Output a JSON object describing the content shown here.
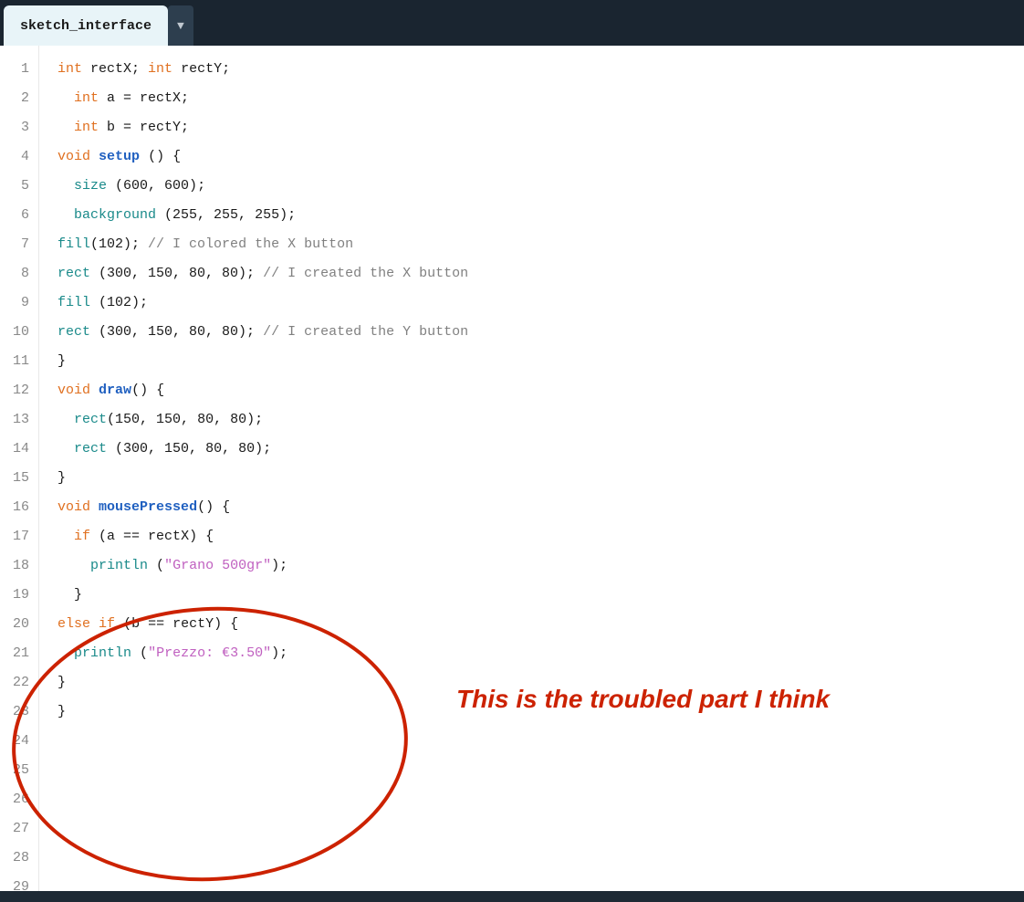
{
  "tab": {
    "label": "sketch_interface",
    "arrow": "▼"
  },
  "lines": [
    {
      "num": 1,
      "tokens": [
        {
          "t": "int",
          "c": "kw-orange"
        },
        {
          "t": " rectX; ",
          "c": "plain"
        },
        {
          "t": "int",
          "c": "kw-orange"
        },
        {
          "t": " rectY;",
          "c": "plain"
        }
      ]
    },
    {
      "num": 2,
      "tokens": [
        {
          "t": "  ",
          "c": "plain"
        },
        {
          "t": "int",
          "c": "kw-orange"
        },
        {
          "t": " a = rectX;",
          "c": "plain"
        }
      ]
    },
    {
      "num": 3,
      "tokens": [
        {
          "t": "  ",
          "c": "plain"
        },
        {
          "t": "int",
          "c": "kw-orange"
        },
        {
          "t": " b = rectY;",
          "c": "plain"
        }
      ]
    },
    {
      "num": 4,
      "tokens": [
        {
          "t": "",
          "c": "plain"
        }
      ]
    },
    {
      "num": 5,
      "tokens": [
        {
          "t": "void",
          "c": "kw-orange"
        },
        {
          "t": " ",
          "c": "plain"
        },
        {
          "t": "setup",
          "c": "kw-blue"
        },
        {
          "t": " () {",
          "c": "plain"
        }
      ]
    },
    {
      "num": 6,
      "tokens": [
        {
          "t": "  ",
          "c": "plain"
        },
        {
          "t": "size",
          "c": "fn-teal"
        },
        {
          "t": " (600, 600);",
          "c": "plain"
        }
      ]
    },
    {
      "num": 7,
      "tokens": [
        {
          "t": "  ",
          "c": "plain"
        },
        {
          "t": "background",
          "c": "fn-teal"
        },
        {
          "t": " (255, 255, 255);",
          "c": "plain"
        }
      ]
    },
    {
      "num": 8,
      "tokens": [
        {
          "t": "",
          "c": "plain"
        }
      ]
    },
    {
      "num": 9,
      "tokens": [
        {
          "t": "fill",
          "c": "fn-teal"
        },
        {
          "t": "(102); ",
          "c": "plain"
        },
        {
          "t": "// I colored the X button",
          "c": "comment"
        }
      ]
    },
    {
      "num": 10,
      "tokens": [
        {
          "t": "rect",
          "c": "fn-teal"
        },
        {
          "t": " (300, 150, 80, 80); ",
          "c": "plain"
        },
        {
          "t": "// I created the X button",
          "c": "comment"
        }
      ]
    },
    {
      "num": 11,
      "tokens": [
        {
          "t": "",
          "c": "plain"
        }
      ]
    },
    {
      "num": 12,
      "tokens": [
        {
          "t": "fill",
          "c": "fn-teal"
        },
        {
          "t": " (102);",
          "c": "plain"
        }
      ]
    },
    {
      "num": 13,
      "tokens": [
        {
          "t": "rect",
          "c": "fn-teal"
        },
        {
          "t": " (300, 150, 80, 80); ",
          "c": "plain"
        },
        {
          "t": "// I created the Y button",
          "c": "comment"
        }
      ]
    },
    {
      "num": 14,
      "tokens": [
        {
          "t": "}",
          "c": "plain"
        }
      ]
    },
    {
      "num": 15,
      "tokens": [
        {
          "t": "",
          "c": "plain"
        }
      ]
    },
    {
      "num": 16,
      "tokens": [
        {
          "t": "void",
          "c": "kw-orange"
        },
        {
          "t": " ",
          "c": "plain"
        },
        {
          "t": "draw",
          "c": "kw-blue"
        },
        {
          "t": "() {",
          "c": "plain"
        }
      ]
    },
    {
      "num": 17,
      "tokens": [
        {
          "t": "  ",
          "c": "plain"
        },
        {
          "t": "rect",
          "c": "fn-teal"
        },
        {
          "t": "(150, 150, 80, 80);",
          "c": "plain"
        }
      ]
    },
    {
      "num": 18,
      "tokens": [
        {
          "t": "  ",
          "c": "plain"
        },
        {
          "t": "rect",
          "c": "fn-teal"
        },
        {
          "t": " (300, 150, 80, 80);",
          "c": "plain"
        }
      ]
    },
    {
      "num": 19,
      "tokens": [
        {
          "t": "}",
          "c": "plain"
        }
      ]
    },
    {
      "num": 20,
      "tokens": [
        {
          "t": "",
          "c": "plain"
        }
      ]
    },
    {
      "num": 21,
      "tokens": [
        {
          "t": "void",
          "c": "kw-orange"
        },
        {
          "t": " ",
          "c": "plain"
        },
        {
          "t": "mousePressed",
          "c": "kw-blue"
        },
        {
          "t": "() {",
          "c": "plain"
        }
      ]
    },
    {
      "num": 22,
      "tokens": [
        {
          "t": "  ",
          "c": "plain"
        },
        {
          "t": "if",
          "c": "kw-orange"
        },
        {
          "t": " (a == rectX) {",
          "c": "plain"
        }
      ]
    },
    {
      "num": 23,
      "tokens": [
        {
          "t": "    ",
          "c": "plain"
        },
        {
          "t": "println",
          "c": "fn-teal"
        },
        {
          "t": " (",
          "c": "plain"
        },
        {
          "t": "\"Grano 500gr\"",
          "c": "str"
        },
        {
          "t": ");",
          "c": "plain"
        }
      ]
    },
    {
      "num": 24,
      "tokens": [
        {
          "t": "  }",
          "c": "plain"
        }
      ]
    },
    {
      "num": 25,
      "tokens": [
        {
          "t": "else",
          "c": "kw-orange"
        },
        {
          "t": " ",
          "c": "plain"
        },
        {
          "t": "if",
          "c": "kw-orange"
        },
        {
          "t": " (b == rectY) {",
          "c": "plain"
        }
      ]
    },
    {
      "num": 26,
      "tokens": [
        {
          "t": "  ",
          "c": "plain"
        },
        {
          "t": "println",
          "c": "fn-teal"
        },
        {
          "t": " (",
          "c": "plain"
        },
        {
          "t": "\"Prezzo: €3.50\"",
          "c": "str"
        },
        {
          "t": ");",
          "c": "plain"
        }
      ]
    },
    {
      "num": 27,
      "tokens": [
        {
          "t": "}",
          "c": "plain"
        }
      ]
    },
    {
      "num": 28,
      "tokens": [
        {
          "t": "}",
          "c": "plain"
        }
      ]
    },
    {
      "num": 29,
      "tokens": [
        {
          "t": "",
          "c": "plain"
        }
      ]
    }
  ],
  "annotation": {
    "text": "This is the troubled part I think"
  }
}
